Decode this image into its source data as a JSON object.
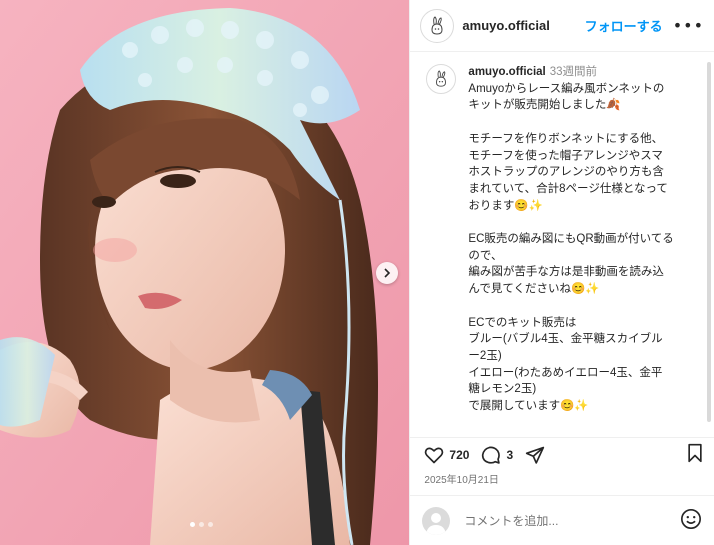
{
  "post": {
    "username": "amuyo.official",
    "follow_label": "フォローする",
    "more_label": "•••",
    "caption": {
      "username": "amuyo.official",
      "time": "33週間前",
      "paragraphs": [
        "Amuyoからレース編み風ボンネットの\nキットが販売開始しました🍂",
        "モチーフを作りボンネットにする他、\nモチーフを使った帽子アレンジやスマ\nホストラップのアレンジのやり方も含\nまれていて、合計8ページ仕様となって\nおります😊✨",
        "EC販売の編み図にもQR動画が付いてる\nので、\n編み図が苦手な方は是非動画を読み込\nんで見てくださいね😊✨",
        "ECでのキット販売は\nブルー(バブル4玉、金平糖スカイブル\nー2玉)\nイエロー(わたあめイエロー4玉、金平\n糖レモン2玉)\nで展開しています😊✨"
      ]
    },
    "likes": "720",
    "comments": "3",
    "date": "2025年10月21日",
    "comment_placeholder": "コメントを追加...",
    "carousel": {
      "count": 3,
      "active": 0
    }
  },
  "colors": {
    "accent": "#0095f6",
    "text": "#262626",
    "muted": "#8e8e8e",
    "background_pink": "#f3a7b6"
  },
  "icons": [
    "rabbit-logo-icon",
    "more-icon",
    "chevron-right-icon",
    "heart-icon",
    "comment-icon",
    "share-icon",
    "bookmark-icon",
    "emoji-icon"
  ]
}
